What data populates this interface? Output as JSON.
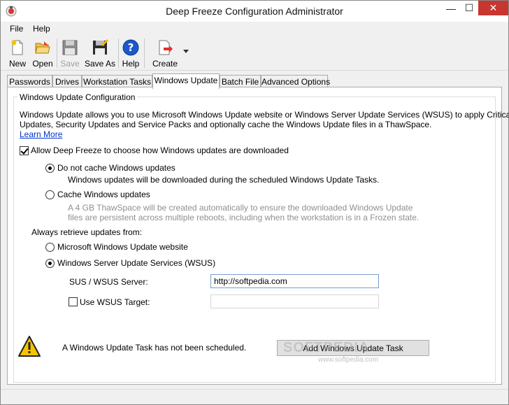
{
  "window": {
    "title": "Deep Freeze Configuration Administrator",
    "controls": {
      "minimize": "—",
      "maximize": "☐",
      "close": "✕"
    }
  },
  "menu": {
    "items": [
      {
        "label": "File"
      },
      {
        "label": "Help"
      }
    ]
  },
  "toolbar": {
    "items": [
      {
        "label": "New",
        "icon": "new-document-icon"
      },
      {
        "label": "Open",
        "icon": "open-folder-icon"
      },
      {
        "label": "Save",
        "icon": "save-floppy-icon",
        "disabled": true
      },
      {
        "label": "Save As",
        "icon": "save-as-icon"
      },
      {
        "label": "Help",
        "icon": "help-icon"
      },
      {
        "label": "Create",
        "icon": "create-icon"
      }
    ]
  },
  "tabs": [
    {
      "label": "Passwords"
    },
    {
      "label": "Drives"
    },
    {
      "label": "Workstation Tasks"
    },
    {
      "label": "Windows Update",
      "active": true
    },
    {
      "label": "Batch File"
    },
    {
      "label": "Advanced Options"
    }
  ],
  "windows_update": {
    "group_title": "Windows Update Configuration",
    "description_line1": "Windows Update allows you to use Microsoft Windows Update website or Windows Server Update Services (WSUS) to apply Critical",
    "description_line2": "Updates, Security Updates and Service Packs and optionally cache the Windows Update files in a ThawSpace.",
    "learn_more": "Learn More",
    "allow_checkbox": {
      "label": "Allow Deep Freeze to choose how Windows updates are downloaded",
      "checked": true
    },
    "cache_options": {
      "no_cache": {
        "label": "Do not cache Windows updates",
        "selected": true,
        "note": "Windows updates will be downloaded during the scheduled Windows Update Tasks."
      },
      "cache": {
        "label": "Cache Windows updates",
        "selected": false,
        "note_line1": "A 4 GB ThawSpace will be created automatically to ensure the downloaded Windows Update",
        "note_line2": "files are persistent across multiple reboots, including when the workstation is in a Frozen state."
      }
    },
    "retrieve_label": "Always retrieve updates from:",
    "sources": {
      "microsoft": {
        "label": "Microsoft Windows Update website",
        "selected": false
      },
      "wsus": {
        "label": "Windows Server Update Services (WSUS)",
        "selected": true
      }
    },
    "server_label": "SUS / WSUS Server:",
    "server_value": "http://softpedia.com",
    "wsus_target": {
      "label": "Use WSUS Target:",
      "checked": false,
      "value": ""
    },
    "warning": "A Windows Update Task has not been scheduled.",
    "add_task_button": "Add Windows Update Task"
  },
  "watermark": {
    "main": "SOFTPEDIA",
    "sub": "www.softpedia.com"
  },
  "colors": {
    "link": "#0033cc",
    "close": "#c7372f",
    "warning": "#f5c400"
  }
}
